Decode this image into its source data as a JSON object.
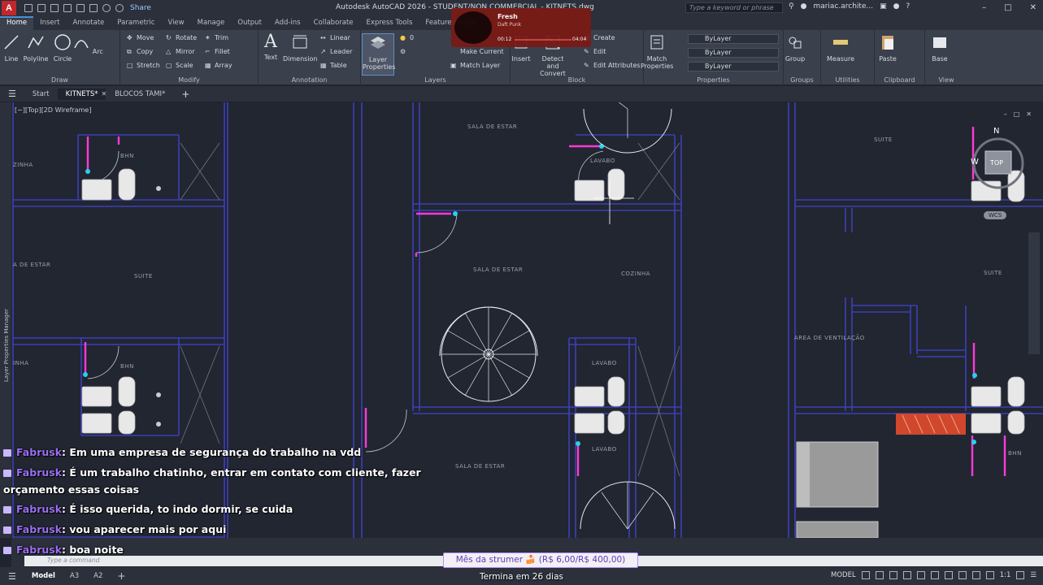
{
  "app": {
    "logo_letter": "A",
    "share_label": "Share",
    "window_title": "Autodesk AutoCAD 2026 - STUDENT/NON COMMERCIAL - KITNETS.dwg",
    "search_placeholder": "Type a keyword or phrase",
    "user_name": "mariac.archite...",
    "colors": {
      "accent": "#4a8fd8",
      "magenta": "#ff3ad7",
      "cyan": "#22d3ee",
      "wall": "#3d3fb8",
      "logo": "#c1272d"
    }
  },
  "ribbon_tabs": [
    "Home",
    "Insert",
    "Annotate",
    "Parametric",
    "View",
    "Manage",
    "Output",
    "Add-ins",
    "Collaborate",
    "Express Tools",
    "Featured Apps"
  ],
  "ribbon": {
    "draw": {
      "title": "Draw",
      "line": "Line",
      "polyline": "Polyline",
      "circle": "Circle",
      "arc": "Arc"
    },
    "modify": {
      "title": "Modify",
      "move": "Move",
      "rotate": "Rotate",
      "trim": "Trim",
      "copy": "Copy",
      "mirror": "Mirror",
      "fillet": "Fillet",
      "stretch": "Stretch",
      "scale": "Scale",
      "array": "Array"
    },
    "annotation": {
      "title": "Annotation",
      "text": "Text",
      "dimension": "Dimension",
      "linear": "Linear",
      "leader": "Leader",
      "table": "Table"
    },
    "layers": {
      "title": "Layers",
      "layer_properties": "Layer Properties",
      "layer_value": "0",
      "make_current": "Make Current",
      "match_layer": "Match Layer"
    },
    "block": {
      "title": "Block",
      "insert": "Insert",
      "detect_convert": "Detect and Convert",
      "create": "Create",
      "edit": "Edit",
      "edit_attributes": "Edit Attributes"
    },
    "properties": {
      "title": "Properties",
      "match_properties": "Match Properties",
      "bylayer_1": "ByLayer",
      "bylayer_2": "ByLayer",
      "bylayer_3": "ByLayer"
    },
    "groups": {
      "title": "Groups",
      "group": "Group"
    },
    "utilities": {
      "title": "Utilities",
      "measure": "Measure"
    },
    "clipboard": {
      "title": "Clipboard",
      "paste": "Paste"
    },
    "view": {
      "title": "View",
      "base": "Base"
    }
  },
  "file_tabs": {
    "start": "Start",
    "kitnets": "KITNETS*",
    "blocos": "BLOCOS TAMI*"
  },
  "viewport": {
    "label": "[−][Top][2D Wireframe]",
    "side_palette_label": "Layer Properties Manager",
    "viewcube": {
      "north": "N",
      "west": "W",
      "top": "TOP",
      "wcs": "WCS"
    },
    "rooms": {
      "sala_top": "SALA DE ESTAR",
      "lavabo_top": "LAVABO",
      "suite_right_top": "SUITE",
      "bhn_left_top": "BHN",
      "sala_left": "A DE ESTAR",
      "suite_left": "SUITE",
      "sala_center": "SALA DE ESTAR",
      "cozinha": "COZINHA",
      "suite_right_mid": "SUITE",
      "area_ventilacao": "AREA DE VENTILAÇÃO",
      "lavabo_mid": "LAVABO",
      "bhn_left_mid": "BHN",
      "lavabo_low": "LAVABO",
      "sala_bottom": "SALA DE ESTAR",
      "bhn_right": "BHN",
      "nha_top": "ZINHA",
      "nha_mid": "INHA"
    }
  },
  "music": {
    "title": "Fresh",
    "artist": "Daft Punk",
    "elapsed": "00:12",
    "duration": "04:04"
  },
  "chat": [
    {
      "user": "Fabrusk",
      "text": ": Em uma empresa de segurança do trabalho na vdd"
    },
    {
      "user": "Fabrusk",
      "text": ": É um trabalho chatinho, entrar em contato com cliente, fazer",
      "continuation": "orçamento essas coisas"
    },
    {
      "user": "Fabrusk",
      "text": ": É isso querida, to indo dormir, se cuida"
    },
    {
      "user": "Fabrusk",
      "text": ": vou aparecer mais por aqui"
    },
    {
      "user": "Fabrusk",
      "text": ": boa noite"
    }
  ],
  "command_line": {
    "placeholder": "Type a command"
  },
  "subscription": {
    "goal": "Mês da strumer 🍰 (R$ 6,00/R$ 400,00)",
    "ends": "Termina em 26 dias"
  },
  "status_bar": {
    "model": "Model",
    "a3": "A3",
    "a2": "A2",
    "model_right": "MODEL",
    "scale": "1:1"
  }
}
